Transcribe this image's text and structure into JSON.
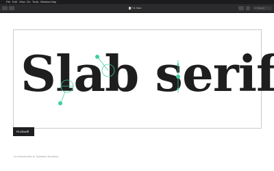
{
  "menubar": {
    "logo": "",
    "items": [
      "File",
      "Edit",
      "View",
      "Go",
      "Tools",
      "Window",
      "Help"
    ]
  },
  "window": {
    "title": "F.6.Slab",
    "search_placeholder": "Search"
  },
  "specimen": {
    "text": "Slab serif",
    "caption": "Rockwell"
  },
  "footer": {
    "text": "An Introduction to Typeface Anatomy"
  },
  "colors": {
    "accent": "#3ecf9c",
    "text": "#1e1e1e",
    "toolbar": "#2b2b2d",
    "menubar": "#1c1c1e"
  }
}
